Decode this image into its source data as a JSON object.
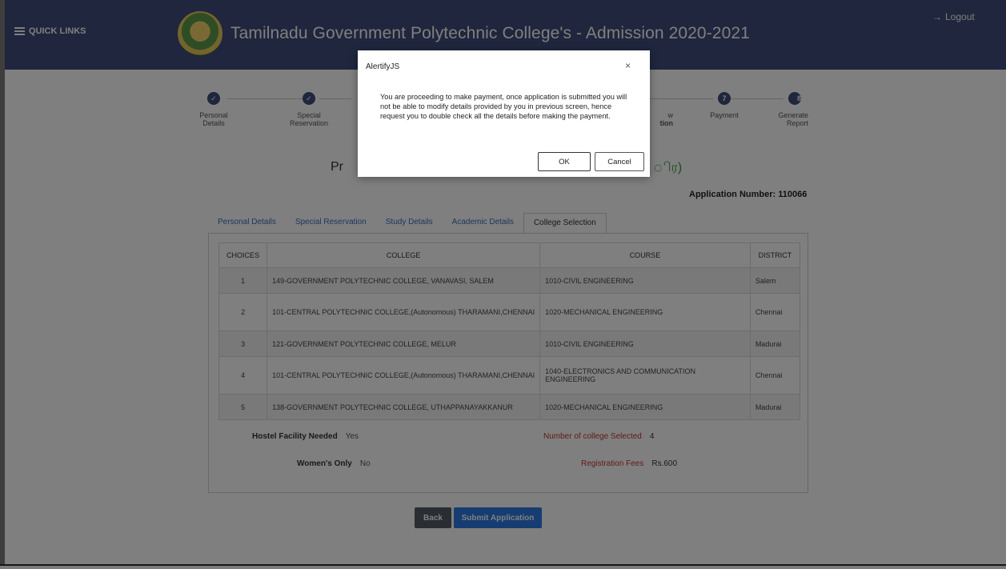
{
  "header": {
    "quick_links": "QUICK LINKS",
    "title": "Tamilnadu Government Polytechnic College's - Admission 2020-2021",
    "logout": "Logout"
  },
  "stepper": {
    "steps": [
      {
        "number": "",
        "label_line1": "Personal",
        "label_line2": "Details",
        "completed": true
      },
      {
        "number": "",
        "label_line1": "Special",
        "label_line2": "Reservation",
        "completed": true
      },
      {
        "number": "",
        "label_line1": "w",
        "label_line2": "tion",
        "completed": false
      },
      {
        "number": "7",
        "label_line1": "Payment",
        "label_line2": "",
        "completed": false
      },
      {
        "number": "8",
        "label_line1": "Generate",
        "label_line2": "Report",
        "completed": false
      }
    ]
  },
  "main": {
    "heading_left": "Pr",
    "heading_right": "ிர)",
    "application_number": "Application Number: 110066",
    "tabs": [
      "Personal Details",
      "Special Reservation",
      "Study Details",
      "Academic Details",
      "College Selection"
    ],
    "active_tab": "College Selection",
    "table": {
      "headers": [
        "CHOICES",
        "COLLEGE",
        "COURSE",
        "DISTRICT"
      ],
      "rows": [
        {
          "choice": "1",
          "college": "149-GOVERNMENT POLYTECHNIC COLLEGE, VANAVASI, SALEM",
          "course": "1010-CIVIL ENGINEERING",
          "district": "Salem"
        },
        {
          "choice": "2",
          "college": "101-CENTRAL POLYTECHNIC COLLEGE,(Autonomous) THARAMANI,CHENNAI",
          "course": "1020-MECHANICAL ENGINEERING",
          "district": "Chennai"
        },
        {
          "choice": "3",
          "college": "121-GOVERNMENT POLYTECHNIC COLLEGE, MELUR",
          "course": "1010-CIVIL ENGINEERING",
          "district": "Madurai"
        },
        {
          "choice": "4",
          "college": "101-CENTRAL POLYTECHNIC COLLEGE,(Autonomous) THARAMANI,CHENNAI",
          "course": "1040-ELECTRONICS AND COMMUNICATION ENGINEERING",
          "district": "Chennai"
        },
        {
          "choice": "5",
          "college": "138-GOVERNMENT POLYTECHNIC COLLEGE, UTHAPPANAYAKKANUR",
          "course": "1020-MECHANICAL ENGINEERING",
          "district": "Madurai"
        }
      ]
    },
    "summary": {
      "hostel_label": "Hostel Facility Needed",
      "hostel_value": "Yes",
      "women_label": "Women's Only",
      "women_value": "No",
      "colleges_label": "Number of college Selected",
      "colleges_value": "4",
      "fees_label": "Registration Fees",
      "fees_value": "Rs.600"
    },
    "buttons": {
      "back": "Back",
      "submit": "Submit Application"
    }
  },
  "dialog": {
    "title": "AlertifyJS",
    "close": "×",
    "message": "You are proceeding to make payment, once application is submitted you will not be able to modify details provided by you in previous screen, hence request you to double check all the details before making the payment.",
    "ok": "OK",
    "cancel": "Cancel"
  },
  "colors": {
    "header_bg": "#3f4d7a",
    "link": "#3a6fb8",
    "accent_red": "#c0392b",
    "submit_button": "#2c7be5",
    "back_button": "#555b63"
  }
}
